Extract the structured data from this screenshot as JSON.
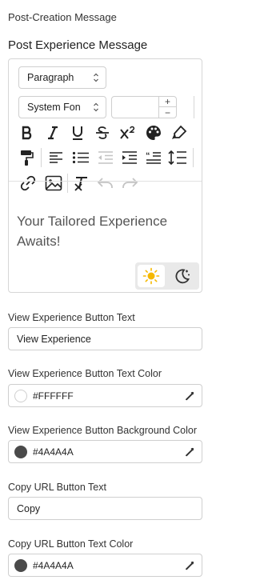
{
  "section_title": "Post-Creation Message",
  "editor": {
    "label": "Post Experience Message",
    "block_format": "Paragraph",
    "font_family": "System Fon",
    "font_size": "",
    "content": "Your Tailored Experience Awaits!",
    "icons": {
      "row1": [
        "bold-icon",
        "italic-icon",
        "underline-icon",
        "strikethrough-icon",
        "superscript-icon",
        "palette-icon",
        "highlighter-icon"
      ],
      "row2": [
        "paint-roller-icon",
        "align-left-icon",
        "bullet-list-icon",
        "outdent-icon",
        "indent-icon",
        "blockquote-icon",
        "line-height-icon"
      ],
      "row3": [
        "link-icon",
        "image-icon",
        "clear-format-icon",
        "undo-icon",
        "redo-icon"
      ]
    },
    "theme": [
      "sun-icon",
      "moon-icon"
    ]
  },
  "fields": {
    "view_text": {
      "label": "View Experience Button Text",
      "value": "View Experience"
    },
    "view_text_color": {
      "label": "View Experience Button Text Color",
      "value": "#FFFFFF"
    },
    "view_bg_color": {
      "label": "View Experience Button Background Color",
      "value": "#4A4A4A"
    },
    "copy_text": {
      "label": "Copy URL Button Text",
      "value": "Copy"
    },
    "copy_text_color": {
      "label": "Copy URL Button Text Color",
      "value": "#4A4A4A"
    }
  },
  "colors": {
    "swatch_dark": "#4A4A4A",
    "sun": "#f5b800",
    "icon": "#222222",
    "disabled": "#c4c4c4"
  }
}
